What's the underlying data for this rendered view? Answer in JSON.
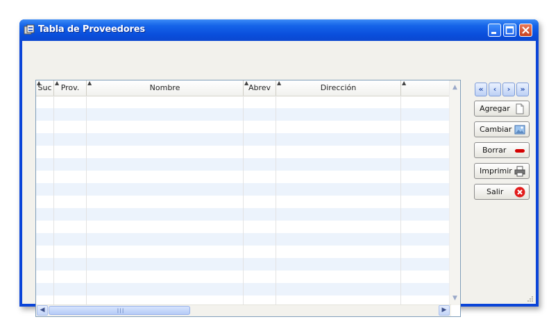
{
  "window": {
    "title": "Tabla de Proveedores"
  },
  "table": {
    "columns": [
      {
        "label": "Suc"
      },
      {
        "label": "Prov."
      },
      {
        "label": "Nombre"
      },
      {
        "label": "Abrev"
      },
      {
        "label": "Dirección"
      },
      {
        "label": ""
      }
    ],
    "rows": []
  },
  "actions": {
    "add": "Agregar",
    "change": "Cambiar",
    "delete": "Borrar",
    "print": "Imprimir",
    "exit": "Salir"
  },
  "colors": {
    "titlebar": "#0a4fdc",
    "stripe": "#ecf3fc",
    "delete_icon": "#d40000",
    "exit_icon": "#e21b1b"
  }
}
